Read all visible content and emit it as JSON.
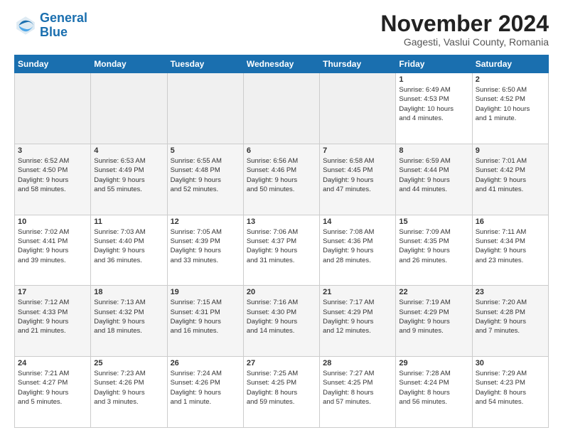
{
  "logo": {
    "line1": "General",
    "line2": "Blue"
  },
  "title": "November 2024",
  "location": "Gagesti, Vaslui County, Romania",
  "days_of_week": [
    "Sunday",
    "Monday",
    "Tuesday",
    "Wednesday",
    "Thursday",
    "Friday",
    "Saturday"
  ],
  "weeks": [
    [
      {
        "day": "",
        "info": ""
      },
      {
        "day": "",
        "info": ""
      },
      {
        "day": "",
        "info": ""
      },
      {
        "day": "",
        "info": ""
      },
      {
        "day": "",
        "info": ""
      },
      {
        "day": "1",
        "info": "Sunrise: 6:49 AM\nSunset: 4:53 PM\nDaylight: 10 hours\nand 4 minutes."
      },
      {
        "day": "2",
        "info": "Sunrise: 6:50 AM\nSunset: 4:52 PM\nDaylight: 10 hours\nand 1 minute."
      }
    ],
    [
      {
        "day": "3",
        "info": "Sunrise: 6:52 AM\nSunset: 4:50 PM\nDaylight: 9 hours\nand 58 minutes."
      },
      {
        "day": "4",
        "info": "Sunrise: 6:53 AM\nSunset: 4:49 PM\nDaylight: 9 hours\nand 55 minutes."
      },
      {
        "day": "5",
        "info": "Sunrise: 6:55 AM\nSunset: 4:48 PM\nDaylight: 9 hours\nand 52 minutes."
      },
      {
        "day": "6",
        "info": "Sunrise: 6:56 AM\nSunset: 4:46 PM\nDaylight: 9 hours\nand 50 minutes."
      },
      {
        "day": "7",
        "info": "Sunrise: 6:58 AM\nSunset: 4:45 PM\nDaylight: 9 hours\nand 47 minutes."
      },
      {
        "day": "8",
        "info": "Sunrise: 6:59 AM\nSunset: 4:44 PM\nDaylight: 9 hours\nand 44 minutes."
      },
      {
        "day": "9",
        "info": "Sunrise: 7:01 AM\nSunset: 4:42 PM\nDaylight: 9 hours\nand 41 minutes."
      }
    ],
    [
      {
        "day": "10",
        "info": "Sunrise: 7:02 AM\nSunset: 4:41 PM\nDaylight: 9 hours\nand 39 minutes."
      },
      {
        "day": "11",
        "info": "Sunrise: 7:03 AM\nSunset: 4:40 PM\nDaylight: 9 hours\nand 36 minutes."
      },
      {
        "day": "12",
        "info": "Sunrise: 7:05 AM\nSunset: 4:39 PM\nDaylight: 9 hours\nand 33 minutes."
      },
      {
        "day": "13",
        "info": "Sunrise: 7:06 AM\nSunset: 4:37 PM\nDaylight: 9 hours\nand 31 minutes."
      },
      {
        "day": "14",
        "info": "Sunrise: 7:08 AM\nSunset: 4:36 PM\nDaylight: 9 hours\nand 28 minutes."
      },
      {
        "day": "15",
        "info": "Sunrise: 7:09 AM\nSunset: 4:35 PM\nDaylight: 9 hours\nand 26 minutes."
      },
      {
        "day": "16",
        "info": "Sunrise: 7:11 AM\nSunset: 4:34 PM\nDaylight: 9 hours\nand 23 minutes."
      }
    ],
    [
      {
        "day": "17",
        "info": "Sunrise: 7:12 AM\nSunset: 4:33 PM\nDaylight: 9 hours\nand 21 minutes."
      },
      {
        "day": "18",
        "info": "Sunrise: 7:13 AM\nSunset: 4:32 PM\nDaylight: 9 hours\nand 18 minutes."
      },
      {
        "day": "19",
        "info": "Sunrise: 7:15 AM\nSunset: 4:31 PM\nDaylight: 9 hours\nand 16 minutes."
      },
      {
        "day": "20",
        "info": "Sunrise: 7:16 AM\nSunset: 4:30 PM\nDaylight: 9 hours\nand 14 minutes."
      },
      {
        "day": "21",
        "info": "Sunrise: 7:17 AM\nSunset: 4:29 PM\nDaylight: 9 hours\nand 12 minutes."
      },
      {
        "day": "22",
        "info": "Sunrise: 7:19 AM\nSunset: 4:29 PM\nDaylight: 9 hours\nand 9 minutes."
      },
      {
        "day": "23",
        "info": "Sunrise: 7:20 AM\nSunset: 4:28 PM\nDaylight: 9 hours\nand 7 minutes."
      }
    ],
    [
      {
        "day": "24",
        "info": "Sunrise: 7:21 AM\nSunset: 4:27 PM\nDaylight: 9 hours\nand 5 minutes."
      },
      {
        "day": "25",
        "info": "Sunrise: 7:23 AM\nSunset: 4:26 PM\nDaylight: 9 hours\nand 3 minutes."
      },
      {
        "day": "26",
        "info": "Sunrise: 7:24 AM\nSunset: 4:26 PM\nDaylight: 9 hours\nand 1 minute."
      },
      {
        "day": "27",
        "info": "Sunrise: 7:25 AM\nSunset: 4:25 PM\nDaylight: 8 hours\nand 59 minutes."
      },
      {
        "day": "28",
        "info": "Sunrise: 7:27 AM\nSunset: 4:25 PM\nDaylight: 8 hours\nand 57 minutes."
      },
      {
        "day": "29",
        "info": "Sunrise: 7:28 AM\nSunset: 4:24 PM\nDaylight: 8 hours\nand 56 minutes."
      },
      {
        "day": "30",
        "info": "Sunrise: 7:29 AM\nSunset: 4:23 PM\nDaylight: 8 hours\nand 54 minutes."
      }
    ]
  ]
}
